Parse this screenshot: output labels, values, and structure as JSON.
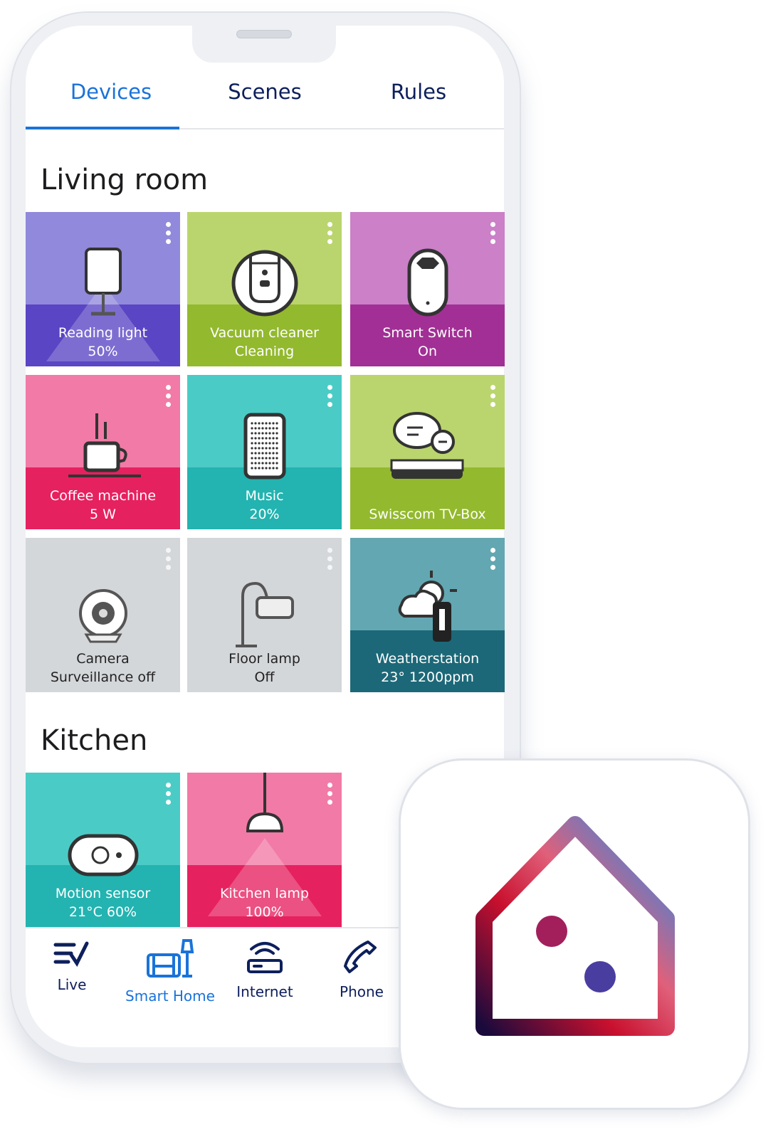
{
  "tabs": [
    {
      "label": "Devices",
      "active": true
    },
    {
      "label": "Scenes"
    },
    {
      "label": "Rules"
    }
  ],
  "sections": {
    "living": "Living room",
    "kitchen": "Kitchen"
  },
  "devices": [
    {
      "name": "Reading light",
      "status": "50%",
      "icon": "reading-lamp-icon",
      "colors": [
        "#9189db",
        "#5a45c4"
      ]
    },
    {
      "name": "Vacuum cleaner",
      "status": "Cleaning",
      "icon": "robot-vacuum-icon",
      "colors": [
        "#bad56e",
        "#93b92e"
      ]
    },
    {
      "name": "Smart Switch",
      "status": "On",
      "icon": "smart-plug-icon",
      "colors": [
        "#cb80c8",
        "#a22f95"
      ]
    },
    {
      "name": "Coffee machine",
      "status": "5 W",
      "icon": "coffee-cup-icon",
      "colors": [
        "#f27aa6",
        "#e6215f"
      ]
    },
    {
      "name": "Music",
      "status": "20%",
      "icon": "speaker-icon",
      "colors": [
        "#4bcbc6",
        "#23b3b0"
      ]
    },
    {
      "name": "Swisscom TV-Box",
      "status": "",
      "icon": "tv-box-icon",
      "colors": [
        "#bad56e",
        "#93b92e"
      ]
    },
    {
      "name": "Camera",
      "status": "Surveillance off",
      "icon": "camera-icon",
      "colors": [
        "#d4d7da",
        "#d4d7da"
      ]
    },
    {
      "name": "Floor lamp",
      "status": "Off",
      "icon": "floor-lamp-icon",
      "colors": [
        "#d4d7da",
        "#d4d7da"
      ]
    },
    {
      "name": "Weatherstation",
      "status": "23° 1200ppm",
      "icon": "weather-station-icon",
      "colors": [
        "#63a7b2",
        "#1c6878"
      ]
    },
    {
      "name": "Motion sensor",
      "status": "21°C   60%",
      "icon": "motion-sensor-icon",
      "colors": [
        "#4bcbc6",
        "#23b3b0"
      ]
    },
    {
      "name": "Kitchen lamp",
      "status": "100%",
      "icon": "pendant-lamp-icon",
      "colors": [
        "#f27aa6",
        "#e6215f"
      ]
    }
  ],
  "nav": [
    {
      "label": "Live",
      "icon": "live-tv-icon"
    },
    {
      "label": "Smart Home",
      "icon": "smart-home-icon",
      "active": true
    },
    {
      "label": "Internet",
      "icon": "router-icon"
    },
    {
      "label": "Phone",
      "icon": "phone-icon"
    }
  ],
  "accent": "#1a73d9"
}
